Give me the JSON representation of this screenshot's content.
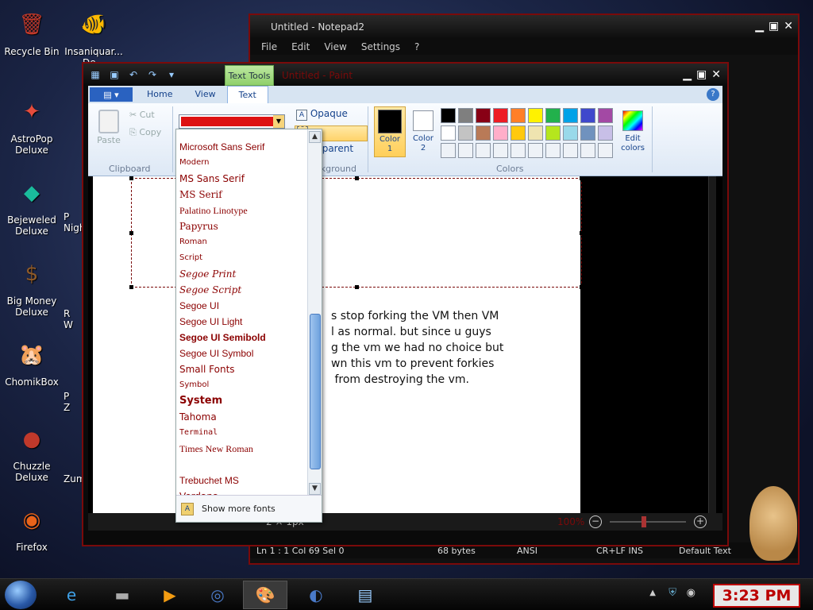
{
  "desktop": {
    "icons": [
      {
        "label": "Recycle Bin",
        "glyph": "🗑",
        "color": "#c0392b"
      },
      {
        "label": "Insaniquar...\nDe...",
        "glyph": "🐠",
        "color": "#e67e22"
      },
      {
        "label": "AstroPop\nDeluxe",
        "glyph": "✦",
        "color": "#e74c3c"
      },
      {
        "label": "Bejeweled\nDeluxe",
        "glyph": "◆",
        "color": "#1abc9c"
      },
      {
        "label": "Big Money\nDeluxe",
        "glyph": "$",
        "color": "#8e5a2a"
      },
      {
        "label": "ChomikBox",
        "glyph": "🐹",
        "color": "#7a9a2a"
      },
      {
        "label": "Chuzzle\nDeluxe",
        "glyph": "●",
        "color": "#c0392b"
      },
      {
        "label": "Firefox",
        "glyph": "◉",
        "color": "#e8631a"
      }
    ],
    "partial_labels": [
      "P\nNigh",
      "R\nW",
      "P\nZ",
      "Zum"
    ]
  },
  "notepad": {
    "title": "Untitled - Notepad2",
    "menu": [
      "File",
      "Edit",
      "View",
      "Settings",
      "?"
    ],
    "status": {
      "position": "Ln 1 : 1   Col 69   Sel 0",
      "size": "68 bytes",
      "encoding": "ANSI",
      "eol": "CR+LF  INS",
      "scheme": "Default Text"
    }
  },
  "paint": {
    "title": "Untitled - Paint",
    "contextual_tab": "Text Tools",
    "tabs": [
      "Home",
      "View",
      "Text"
    ],
    "active_tab": "Text",
    "clipboard": {
      "paste": "Paste",
      "cut": "Cut",
      "copy": "Copy",
      "label": "Clipboard"
    },
    "font_box_value": "",
    "background": {
      "opaque": "Opaque",
      "transparent": "Transparent",
      "label": "Background"
    },
    "colors": {
      "color1_label": "Color\n1",
      "color2_label": "Color\n2",
      "edit_colors": "Edit\ncolors",
      "group_label": "Colors",
      "color1": "#000000",
      "color2": "#ffffff",
      "palette_row1": [
        "#000000",
        "#7f7f7f",
        "#880015",
        "#ed1c24",
        "#ff7f27",
        "#fff200",
        "#22b14c",
        "#00a2e8",
        "#3f48cc",
        "#a349a4"
      ],
      "palette_row2": [
        "#ffffff",
        "#c3c3c3",
        "#b97a57",
        "#ffaec9",
        "#ffc90e",
        "#efe4b0",
        "#b5e61d",
        "#99d9ea",
        "#7092be",
        "#c8bfe7"
      ]
    },
    "canvas_text": "s stop forking the VM then VM\nl as normal. but since u guys\ng the vm we had no choice but\nwn this vm to prevent forkies\n from destroying the vm.",
    "status_size": "2 × 1px",
    "zoom": "100%"
  },
  "font_dropdown": {
    "fonts": [
      "Microsoft Sans Serif",
      "Modern",
      "MS Sans Serif",
      "MS Serif",
      "Palatino Linotype",
      "Papyrus",
      "Roman",
      "Script",
      "Segoe Print",
      "Segoe Script",
      "Segoe UI",
      "Segoe UI Light",
      "Segoe UI Semibold",
      "Segoe UI Symbol",
      "Small Fonts",
      "Symbol",
      "System",
      "Tahoma",
      "Terminal",
      "Times New Roman",
      "",
      "Trebuchet MS",
      "Verdana"
    ],
    "show_more": "Show more fonts"
  },
  "taskbar": {
    "clock": "3:23 PM"
  }
}
